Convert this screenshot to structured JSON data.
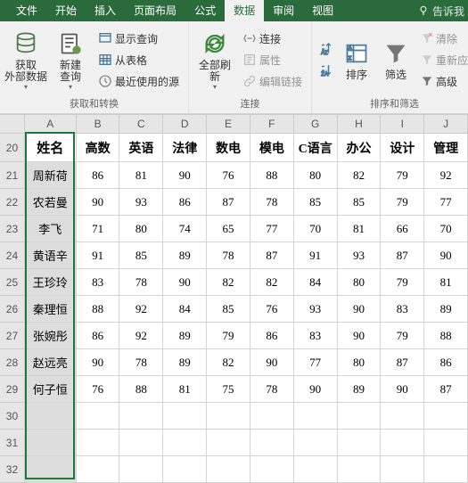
{
  "menu": {
    "tabs": [
      "文件",
      "开始",
      "插入",
      "页面布局",
      "公式",
      "数据",
      "审阅",
      "视图"
    ],
    "active": 5,
    "help": "告诉我"
  },
  "ribbon": {
    "group1": {
      "get_external": "获取\n外部数据",
      "new_query": "新建\n查询",
      "show_query": "显示查询",
      "from_table": "从表格",
      "recent_sources": "最近使用的源",
      "label": "获取和转换"
    },
    "group2": {
      "refresh_all": "全部刷新",
      "connections": "连接",
      "properties": "属性",
      "edit_links": "编辑链接",
      "label": "连接"
    },
    "group3": {
      "sort": "排序",
      "filter": "筛选",
      "clear": "清除",
      "reapply": "重新应",
      "advanced": "高级",
      "label": "排序和筛选"
    }
  },
  "chart_data": {
    "type": "table",
    "columns": [
      "姓名",
      "高数",
      "英语",
      "法律",
      "数电",
      "模电",
      "C语言",
      "办公",
      "设计",
      "管理"
    ],
    "row_headers": [
      20,
      21,
      22,
      23,
      24,
      25,
      26,
      27,
      28,
      29,
      30,
      31,
      32
    ],
    "col_letters": [
      "A",
      "B",
      "C",
      "D",
      "E",
      "F",
      "G",
      "H",
      "I",
      "J"
    ],
    "rows": [
      [
        "周新荷",
        86,
        81,
        90,
        76,
        88,
        80,
        82,
        79,
        92
      ],
      [
        "农若曼",
        90,
        93,
        86,
        87,
        78,
        85,
        85,
        79,
        77
      ],
      [
        "李飞",
        71,
        80,
        74,
        65,
        77,
        70,
        81,
        66,
        70
      ],
      [
        "黄语辛",
        91,
        85,
        89,
        78,
        87,
        91,
        93,
        87,
        90
      ],
      [
        "王珍玲",
        83,
        78,
        90,
        82,
        82,
        84,
        80,
        79,
        81
      ],
      [
        "秦理恒",
        88,
        92,
        84,
        85,
        76,
        93,
        90,
        83,
        89
      ],
      [
        "张婉彤",
        86,
        92,
        89,
        79,
        86,
        83,
        90,
        79,
        88
      ],
      [
        "赵远亮",
        90,
        78,
        89,
        82,
        90,
        77,
        80,
        87,
        86
      ],
      [
        "何子恒",
        76,
        88,
        81,
        75,
        78,
        90,
        89,
        90,
        87
      ]
    ],
    "selection": {
      "col": "A",
      "rows": [
        20,
        32
      ]
    }
  }
}
